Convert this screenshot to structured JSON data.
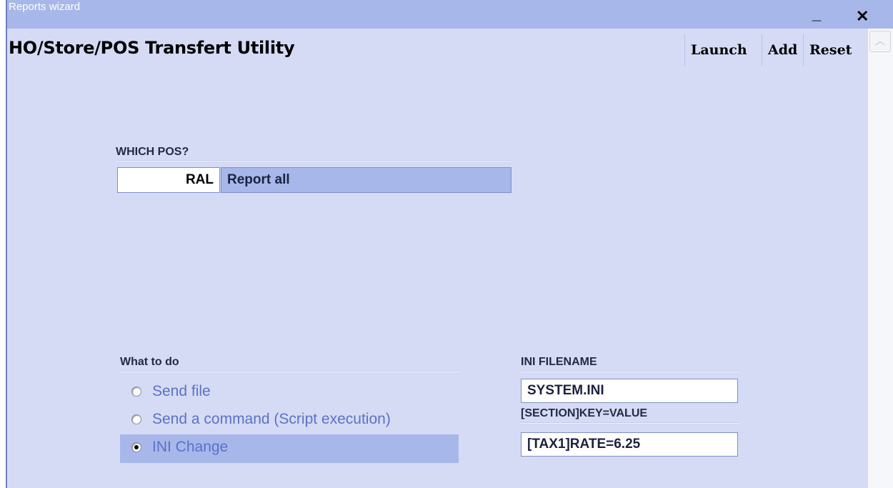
{
  "window": {
    "title": "Reports wizard",
    "minimize_symbol": "_",
    "close_symbol": "✕"
  },
  "header": {
    "app_title": "HO/Store/POS Transfert Utility",
    "launch_label": "Launch",
    "add_label": "Add",
    "reset_label": "Reset"
  },
  "scrollbar": {
    "up_arrow_icon": "chevron-up-icon",
    "up_symbol": "︿"
  },
  "pos": {
    "label": "WHICH POS?",
    "code": "RAL",
    "description": "Report all"
  },
  "action": {
    "label": "What to do",
    "options": [
      {
        "label": "Send file",
        "selected": false
      },
      {
        "label": "Send a command (Script execution)",
        "selected": false
      },
      {
        "label": "INI Change",
        "selected": true
      }
    ]
  },
  "ini": {
    "filename_label": "INI FILENAME",
    "filename_value": "SYSTEM.INI",
    "key_label": "[SECTION]KEY=VALUE",
    "key_value": "[TAX1]RATE=6.25"
  },
  "colors": {
    "window_bg": "#d5dbf5",
    "titlebar_bg": "#a7b7e9",
    "selected_row_bg": "#a7b7e9",
    "radio_text": "#5b72c8"
  }
}
